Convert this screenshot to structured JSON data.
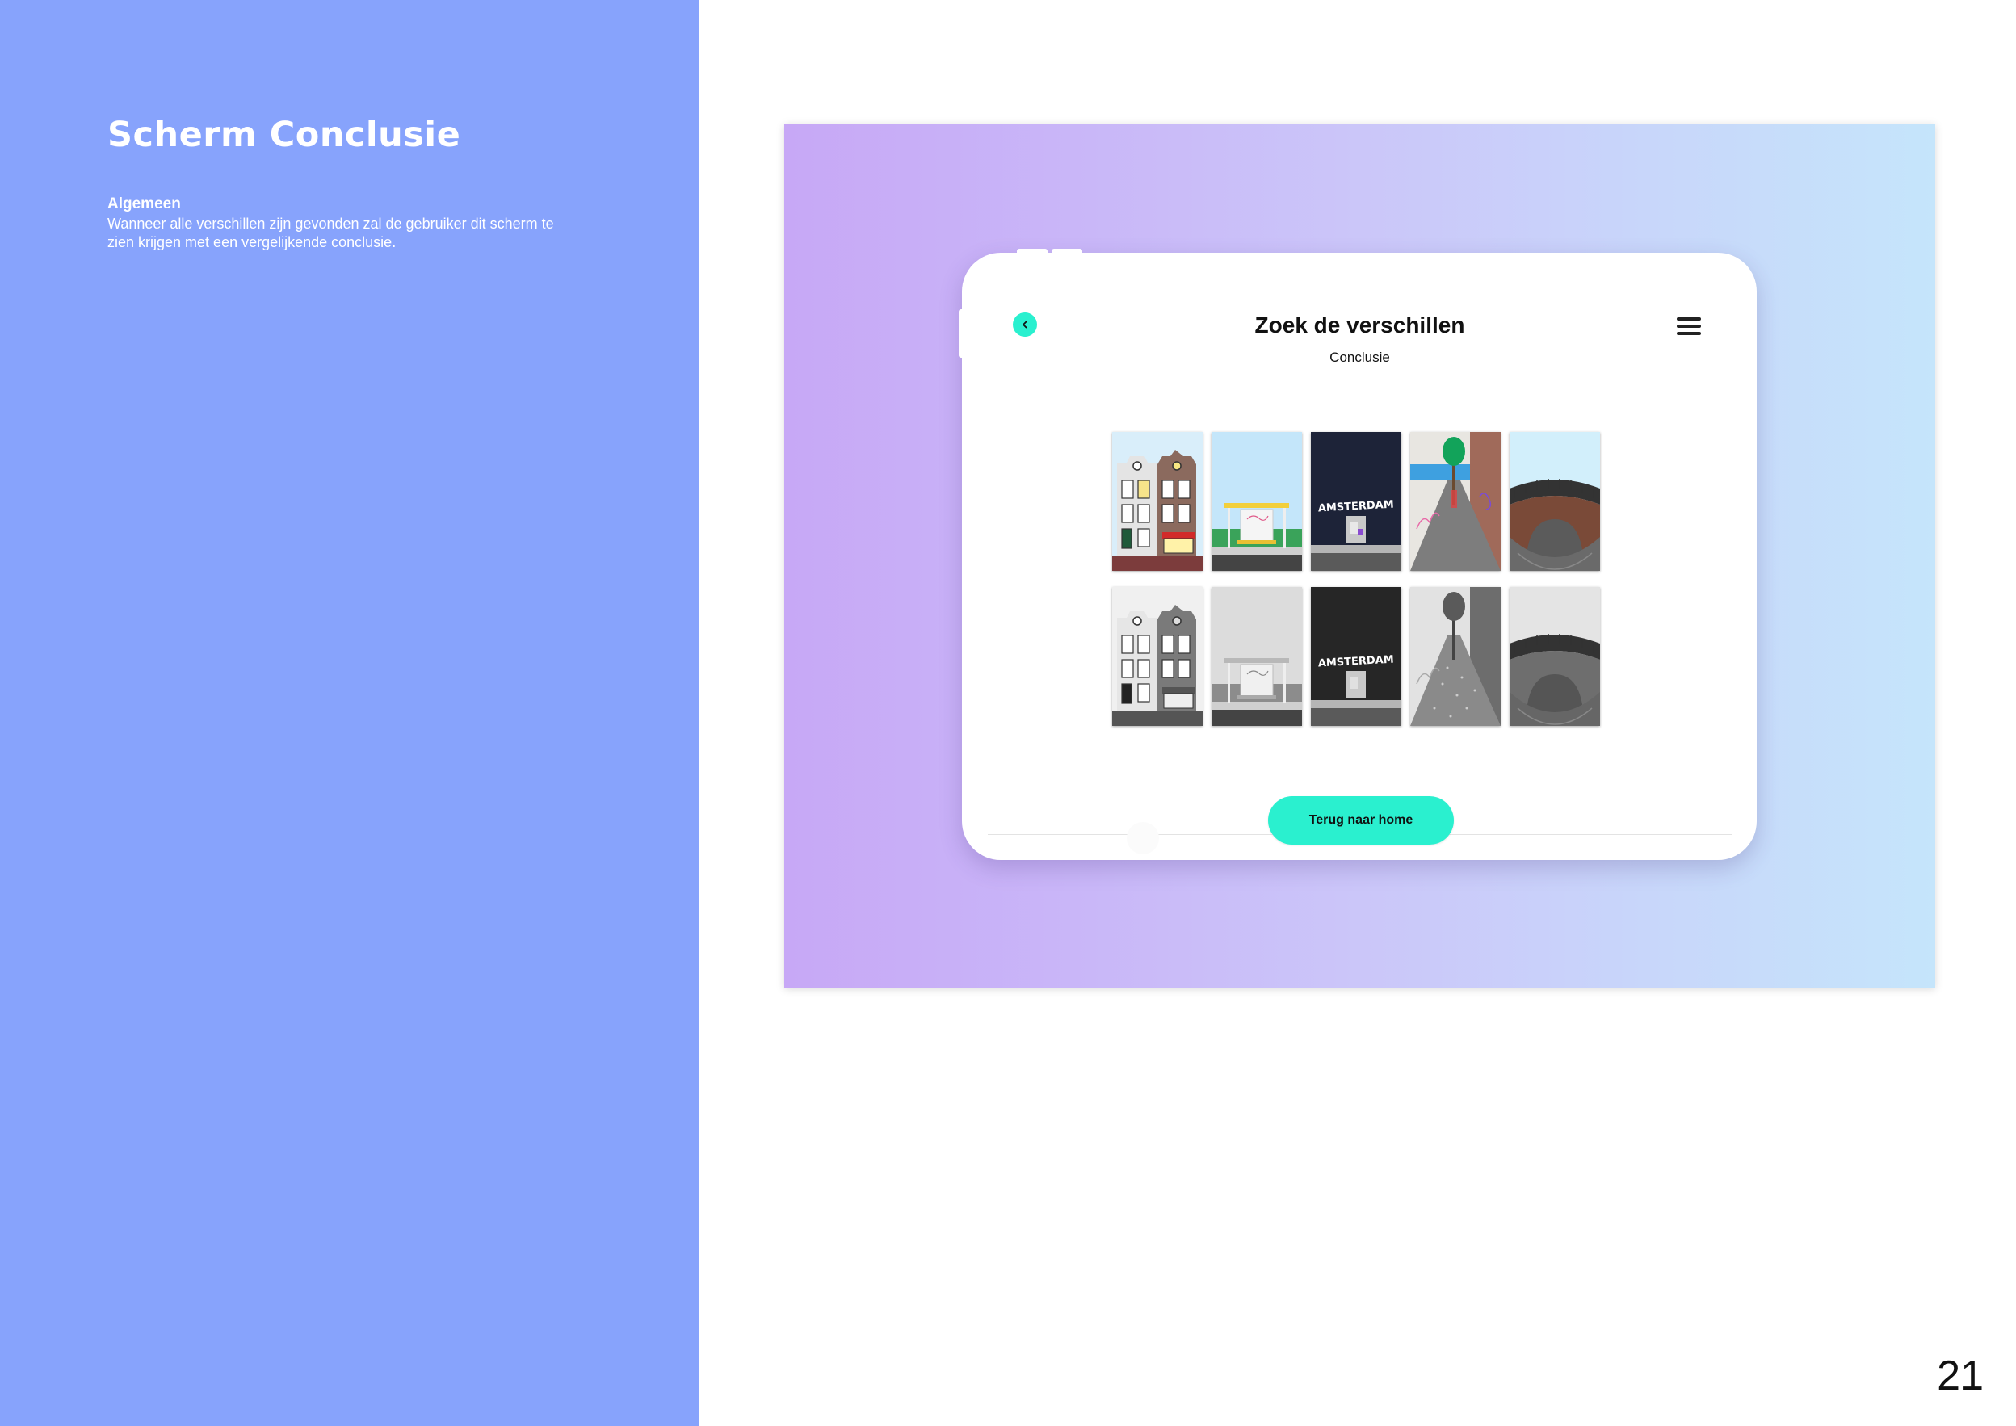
{
  "slide": {
    "title": "Scherm Conclusie",
    "section_title": "Algemeen",
    "section_text": "Wanneer alle verschillen zijn gevonden zal de gebruiker dit scherm te zien krijgen met een vergelijkende conclusie.",
    "page_number": "21"
  },
  "app": {
    "title": "Zoek de verschillen",
    "subtitle": "Conclusie",
    "back_icon": "chevron-left-icon",
    "menu_icon": "hamburger-menu-icon",
    "cta_label": "Terug naar home",
    "accent_color": "#2af0cf"
  },
  "thumbnails": {
    "color_row": [
      "Huizen",
      "Tramhalte",
      "Amsterdam muur",
      "Steeg",
      "Brug"
    ],
    "gray_row": [
      "Huizen",
      "Tramhalte",
      "Amsterdam muur",
      "Steeg",
      "Brug"
    ],
    "wall_text": "AMSTERDAM"
  }
}
